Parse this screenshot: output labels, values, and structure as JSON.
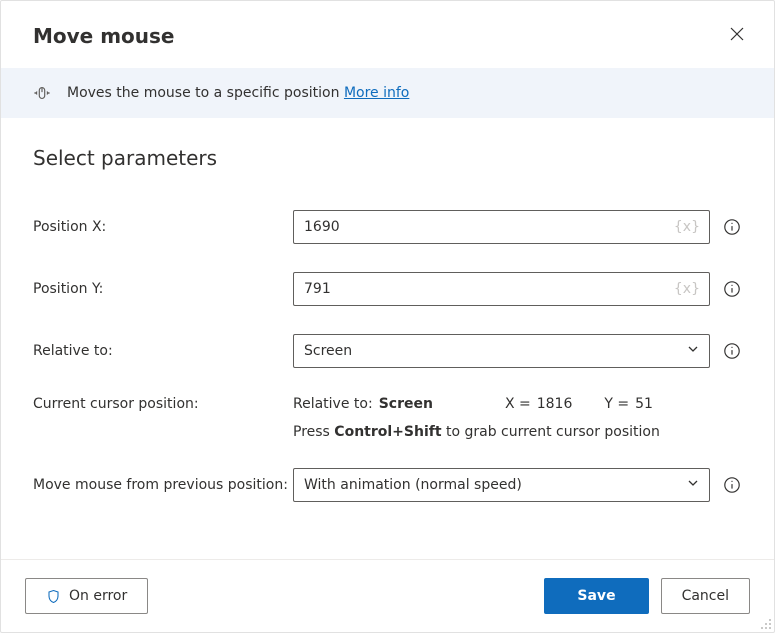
{
  "header": {
    "title": "Move mouse"
  },
  "banner": {
    "description": "Moves the mouse to a specific position ",
    "link_label": "More info"
  },
  "section_title": "Select parameters",
  "fields": {
    "position_x": {
      "label": "Position X:",
      "value": "1690",
      "var_hint": "{x}"
    },
    "position_y": {
      "label": "Position Y:",
      "value": "791",
      "var_hint": "{x}"
    },
    "relative_to": {
      "label": "Relative to:",
      "selected": "Screen"
    },
    "cursor": {
      "label": "Current cursor position:",
      "rel_label": "Relative to:",
      "rel_value": "Screen",
      "x_label": "X =",
      "x_value": "1816",
      "y_label": "Y =",
      "y_value": "51",
      "hint_prefix": "Press ",
      "hint_keys": "Control+Shift",
      "hint_suffix": " to grab current cursor position"
    },
    "move_mode": {
      "label": "Move mouse from previous position:",
      "selected": "With animation (normal speed)"
    }
  },
  "footer": {
    "on_error": "On error",
    "save": "Save",
    "cancel": "Cancel"
  }
}
